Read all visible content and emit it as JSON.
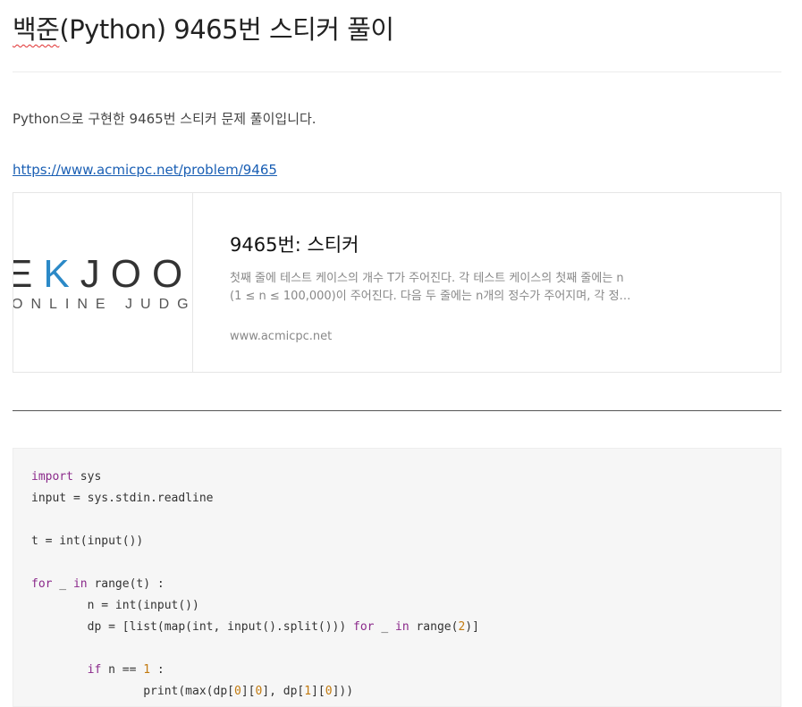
{
  "post": {
    "title_underlined": "백준",
    "title_rest": "(Python) 9465번 스티커 풀이",
    "intro": "Python으로 구현한 9465번 스티커 문제 풀이입니다.",
    "problem_url": "https://www.acmicpc.net/problem/9465"
  },
  "link_card": {
    "logo_text_start": "E",
    "logo_text_accent": "K",
    "logo_text_end": "JOO",
    "logo_subtext": "ONLINE JUDGE",
    "title": "9465번: 스티커",
    "description_line1": "첫째 줄에 테스트 케이스의 개수 T가 주어진다. 각 테스트 케이스의 첫째 줄에는 n",
    "description_line2": "(1 ≤ n ≤ 100,000)이 주어진다. 다음 두 줄에는 n개의 정수가 주어지며, 각 정…",
    "domain": "www.acmicpc.net"
  },
  "code": {
    "lines": [
      [
        {
          "t": "import",
          "c": "kw"
        },
        {
          "t": " sys"
        }
      ],
      [
        {
          "t": "input = sys.stdin.readline"
        }
      ],
      [],
      [
        {
          "t": "t = int(input())"
        }
      ],
      [],
      [
        {
          "t": "for",
          "c": "kw"
        },
        {
          "t": " _ "
        },
        {
          "t": "in",
          "c": "kw"
        },
        {
          "t": " range(t) :"
        }
      ],
      [
        {
          "t": "        n = int(input())"
        }
      ],
      [
        {
          "t": "        dp = [list(map(int, input().split())) "
        },
        {
          "t": "for",
          "c": "kw"
        },
        {
          "t": " _ "
        },
        {
          "t": "in",
          "c": "kw"
        },
        {
          "t": " range("
        },
        {
          "t": "2",
          "c": "num"
        },
        {
          "t": ")]"
        }
      ],
      [],
      [
        {
          "t": "        "
        },
        {
          "t": "if",
          "c": "kw"
        },
        {
          "t": " n == "
        },
        {
          "t": "1",
          "c": "num"
        },
        {
          "t": " :"
        }
      ],
      [
        {
          "t": "                print(max(dp["
        },
        {
          "t": "0",
          "c": "num"
        },
        {
          "t": "]["
        },
        {
          "t": "0",
          "c": "num"
        },
        {
          "t": "], dp["
        },
        {
          "t": "1",
          "c": "num"
        },
        {
          "t": "]["
        },
        {
          "t": "0",
          "c": "num"
        },
        {
          "t": "]))"
        }
      ]
    ]
  }
}
